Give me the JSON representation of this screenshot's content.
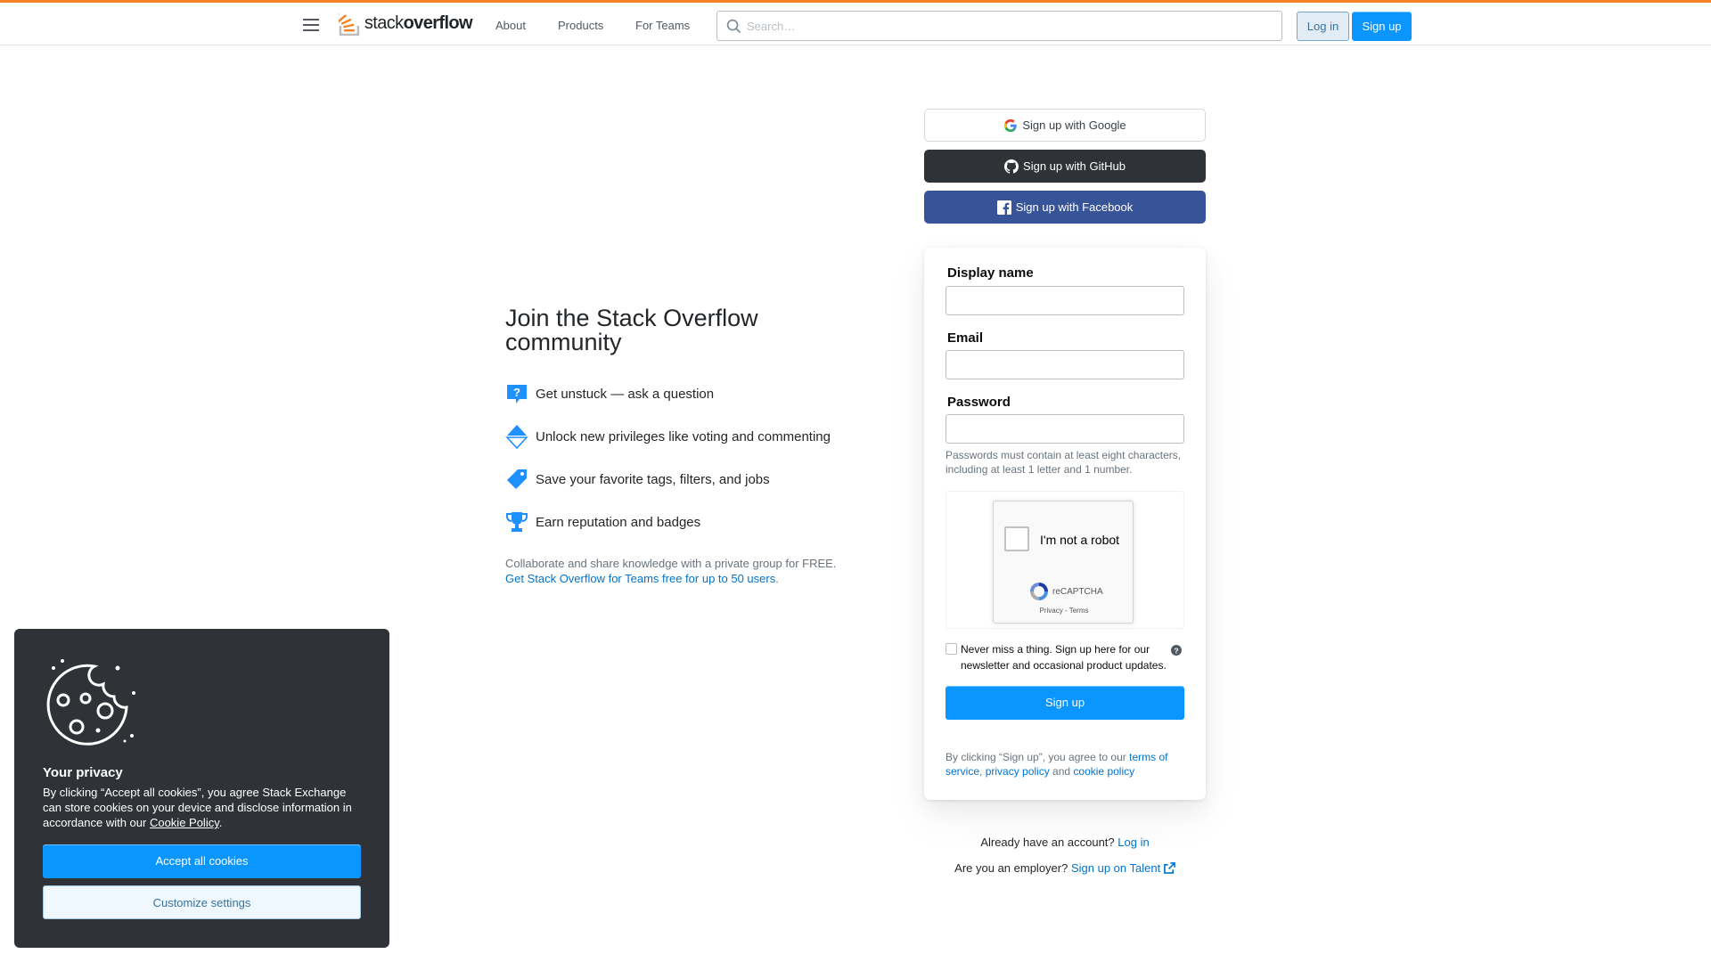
{
  "header": {
    "logo": {
      "light": "stack",
      "bold": "overflow"
    },
    "nav": [
      {
        "label": "About"
      },
      {
        "label": "Products"
      },
      {
        "label": "For Teams"
      }
    ],
    "search": {
      "placeholder": "Search…",
      "value": ""
    },
    "login_label": "Log in",
    "signup_label": "Sign up"
  },
  "intro": {
    "title": "Join the Stack Overflow community",
    "features": [
      {
        "icon": "question-bubble-icon",
        "text": "Get unstuck — ask a question"
      },
      {
        "icon": "vote-arrows-icon",
        "text": "Unlock new privileges like voting and commenting"
      },
      {
        "icon": "tag-icon",
        "text": "Save your favorite tags, filters, and jobs"
      },
      {
        "icon": "trophy-icon",
        "text": "Earn reputation and badges"
      }
    ],
    "teams_note": "Collaborate and share knowledge with a private group for FREE.",
    "teams_link": "Get Stack Overflow for Teams free for up to 50 users"
  },
  "oauth": {
    "google": "Sign up with Google",
    "github": "Sign up with GitHub",
    "facebook": "Sign up with Facebook"
  },
  "form": {
    "display_name_label": "Display name",
    "display_name_value": "",
    "email_label": "Email",
    "email_value": "",
    "password_label": "Password",
    "password_value": "",
    "password_hint": "Passwords must contain at least eight characters, including at least 1 letter and 1 number.",
    "captcha": {
      "label": "I'm not a robot",
      "brand": "reCAPTCHA",
      "links": "Privacy - Terms"
    },
    "newsletter_text": "Never miss a thing. Sign up here for our newsletter and occasional product updates.",
    "newsletter_checked": false,
    "submit_label": "Sign up",
    "terms_prefix": "By clicking “Sign up”, you agree to our ",
    "terms_link": "terms of service",
    "terms_sep": ", ",
    "privacy_link": "privacy policy",
    "terms_and": " and ",
    "cookie_link": "cookie policy"
  },
  "footer_links": {
    "have_account": "Already have an account?",
    "login_link": "Log in",
    "employer": "Are you an employer?",
    "talent_link": "Sign up on Talent"
  },
  "cookie_banner": {
    "title": "Your privacy",
    "body": "By clicking “Accept all cookies”, you agree Stack Exchange can store cookies on your device and disclose information in accordance with our ",
    "policy_link": "Cookie Policy",
    "body_end": ".",
    "accept_label": "Accept all cookies",
    "customize_label": "Customize settings"
  },
  "colors": {
    "accent_orange": "#f48225",
    "primary_blue": "#0a95ff",
    "link_blue": "#0074cc",
    "github_dark": "#2f3337",
    "facebook_blue": "#385499",
    "banner_bg": "#2f3337"
  }
}
